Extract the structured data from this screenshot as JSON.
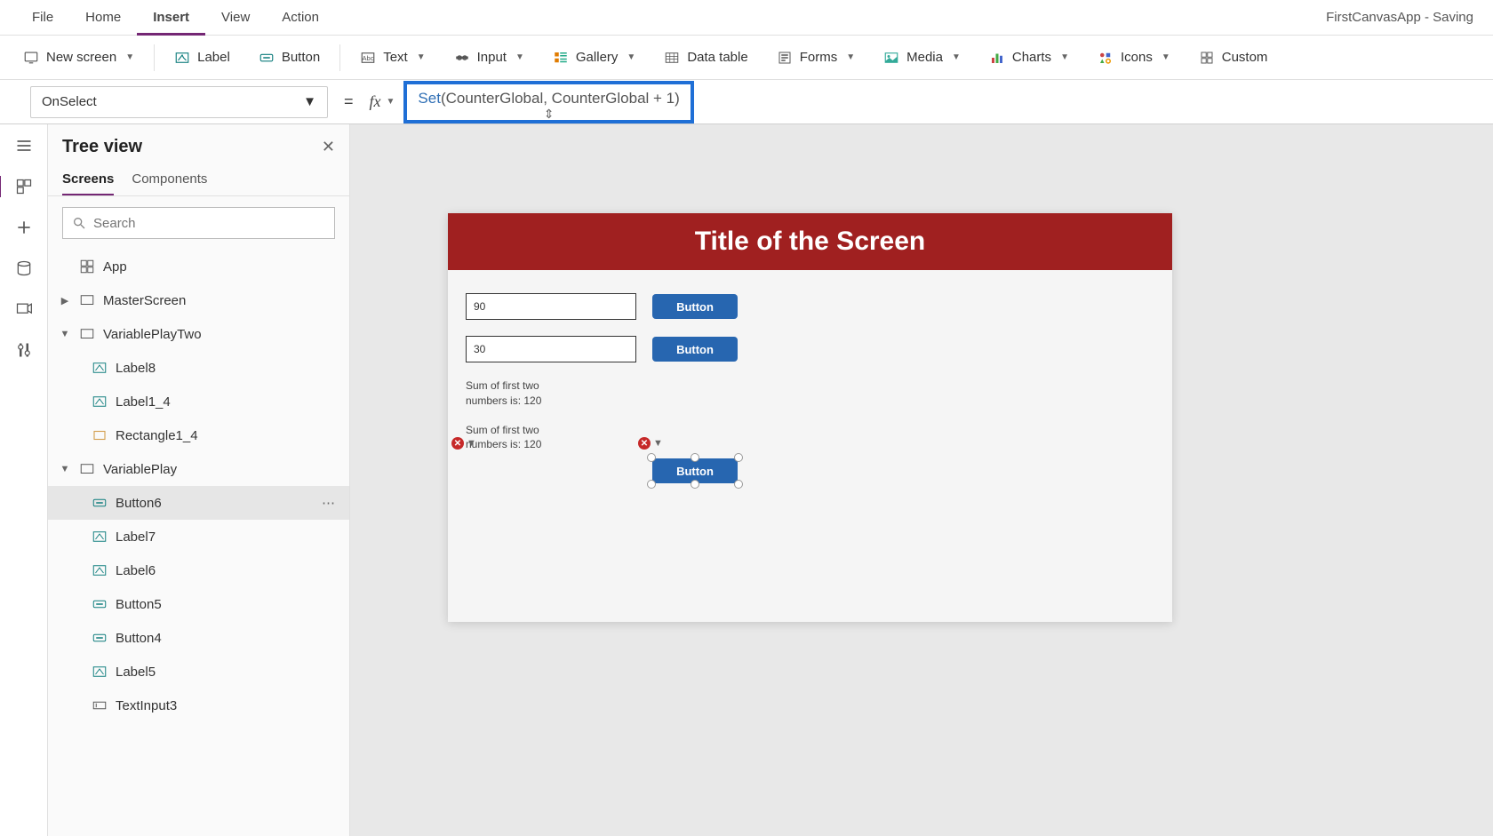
{
  "menubar": {
    "items": [
      "File",
      "Home",
      "Insert",
      "View",
      "Action"
    ],
    "activeIndex": 2,
    "appStatus": "FirstCanvasApp - Saving"
  },
  "ribbon": {
    "newScreen": "New screen",
    "label": "Label",
    "button": "Button",
    "text": "Text",
    "input": "Input",
    "gallery": "Gallery",
    "dataTable": "Data table",
    "forms": "Forms",
    "media": "Media",
    "charts": "Charts",
    "icons": "Icons",
    "custom": "Custom"
  },
  "formula": {
    "property": "OnSelect",
    "func": "Set",
    "args": "(CounterGlobal, CounterGlobal + 1)"
  },
  "treeview": {
    "title": "Tree view",
    "tabs": [
      "Screens",
      "Components"
    ],
    "activeTab": 0,
    "searchPlaceholder": "Search",
    "nodes": {
      "app": "App",
      "masterScreen": "MasterScreen",
      "variablePlayTwo": "VariablePlayTwo",
      "label8": "Label8",
      "label1_4": "Label1_4",
      "rectangle1_4": "Rectangle1_4",
      "variablePlay": "VariablePlay",
      "button6": "Button6",
      "label7": "Label7",
      "label6": "Label6",
      "button5": "Button5",
      "button4": "Button4",
      "label5": "Label5",
      "textInput3": "TextInput3"
    }
  },
  "canvas": {
    "screenTitle": "Title of the Screen",
    "input1": "90",
    "input2": "30",
    "button1": "Button",
    "button2": "Button",
    "button3": "Button",
    "sum1": "Sum of first two numbers is: 120",
    "sum2": "Sum of first two numbers is: 120"
  }
}
